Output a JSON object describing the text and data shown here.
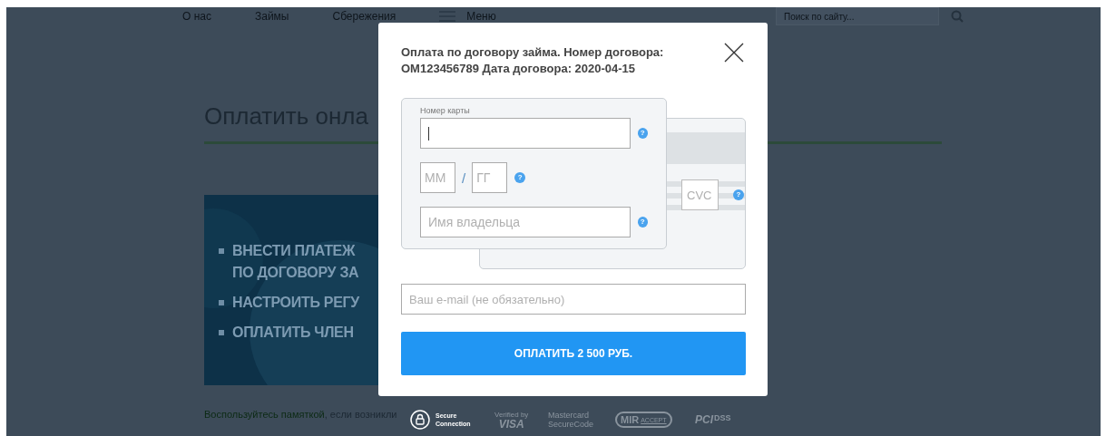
{
  "nav": {
    "items": [
      "О нас",
      "Займы",
      "Сбережения"
    ],
    "menu_label": "Меню",
    "search": {
      "placeholder": "Поиск по сайту..."
    }
  },
  "page": {
    "heading": "Оплатить онла",
    "banner": {
      "kind": "picture",
      "lines": [
        {
          "text": "ВНЕСТИ ПЛАТЕЖ",
          "bullet": true
        },
        {
          "text": "ПО ДОГОВОРУ ЗА",
          "bullet": false
        },
        {
          "text": "НАСТРОИТЬ РЕГУ",
          "bullet": true
        },
        {
          "text": "ОПЛАТИТЬ ЧЛЕН",
          "bullet": true
        }
      ]
    },
    "note": {
      "link": "Воспользуйтесь памяткой",
      "text": ", если возникли"
    }
  },
  "modal": {
    "title": "Оплата по договору займа. Номер договора: ОМ123456789 Дата договора: 2020-04-15",
    "card": {
      "number": {
        "label": "Номер карты",
        "focused": true,
        "help": "?"
      },
      "expiry": {
        "month_placeholder": "ММ",
        "separator": "/",
        "year_placeholder": "ГГ",
        "help": "?"
      },
      "holder": {
        "placeholder": "Имя владельца",
        "help": "?"
      },
      "cvc": {
        "placeholder": "CVC",
        "help": "?"
      }
    },
    "email": {
      "placeholder": "Ваш e-mail (не обязательно)"
    },
    "pay_button": "ОПЛАТИТЬ 2 500 РУБ."
  },
  "badges": [
    {
      "kind": "secure",
      "lines": [
        "Secure",
        "Connection"
      ]
    },
    {
      "kind": "visa",
      "lines": [
        "Verified by",
        "VISA"
      ]
    },
    {
      "kind": "mastercard",
      "lines": [
        "Mastercard",
        "SecureCode"
      ]
    },
    {
      "kind": "mir",
      "lines": [
        "MIR",
        "ACCEPT"
      ]
    },
    {
      "kind": "pci",
      "lines": [
        "PCI",
        "DSS"
      ]
    }
  ]
}
